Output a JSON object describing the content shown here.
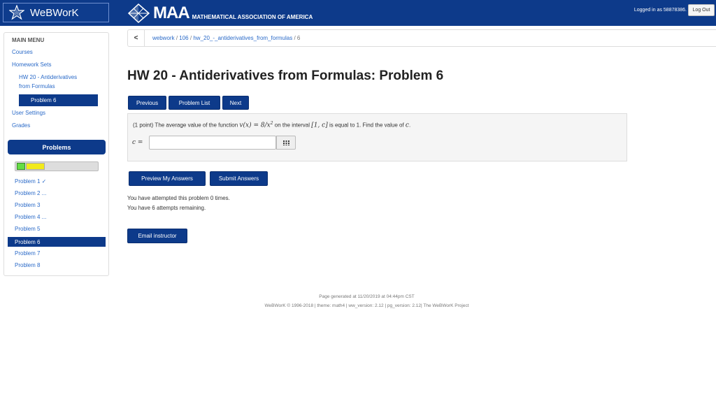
{
  "header": {
    "brand": "WeBWorK",
    "maa_logo_text": "MAA",
    "maa_subtitle": "MATHEMATICAL ASSOCIATION OF AMERICA",
    "logged_in": "Logged in as 58878386.",
    "logout_label": "Log Out"
  },
  "sidebar": {
    "menu_title": "MAIN MENU",
    "courses": "Courses",
    "homework_sets": "Homework Sets",
    "current_set_line1": "HW 20 - Antiderivatives",
    "current_set_line2": "from Formulas",
    "current_problem": "Problem 6",
    "user_settings": "User Settings",
    "grades": "Grades",
    "problems_header": "Problems",
    "problems": [
      "Problem 1 ✓",
      "Problem 2 ...",
      "Problem 3",
      "Problem 4 ...",
      "Problem 5",
      "Problem 6",
      "Problem 7",
      "Problem 8"
    ]
  },
  "breadcrumb": {
    "back": "<",
    "items": [
      "webwork",
      "106",
      "hw_20_-_antiderivatives_from_formulas",
      "6"
    ],
    "sep": "/"
  },
  "main": {
    "title": "HW 20 - Antiderivatives from Formulas: Problem 6",
    "nav": {
      "previous": "Previous",
      "problem_list": "Problem List",
      "next": "Next"
    },
    "problem": {
      "intro": "(1 point) The average value of the function ",
      "func": "v(x) = 8/x",
      "func_exp": "2",
      "mid": " on the interval ",
      "interval": "[1, c]",
      "end": " is equal to 1. Find the value of ",
      "var": "c",
      "period": ".",
      "answer_label": "c =",
      "answer_value": ""
    },
    "buttons": {
      "preview": "Preview My Answers",
      "submit": "Submit Answers",
      "email": "Email instructor"
    },
    "attempts_line1": "You have attempted this problem 0 times.",
    "attempts_line2": "You have 6 attempts remaining."
  },
  "footer": {
    "line1": "Page generated at 11/20/2019 at 04:44pm CST",
    "line2": "WeBWorK © 1996-2018 | theme: math4 | ww_version: 2.12 | pg_version: 2.12| The WeBWorK Project"
  },
  "colors": {
    "navy": "#0d3a8a",
    "link": "#2a6ac8",
    "progress_green": "#66dd44",
    "progress_yellow": "#f2ea1a"
  },
  "icons": [
    "webwork-star-icon",
    "maa-logo-icon",
    "back-chevron-icon",
    "equation-grid-icon"
  ]
}
